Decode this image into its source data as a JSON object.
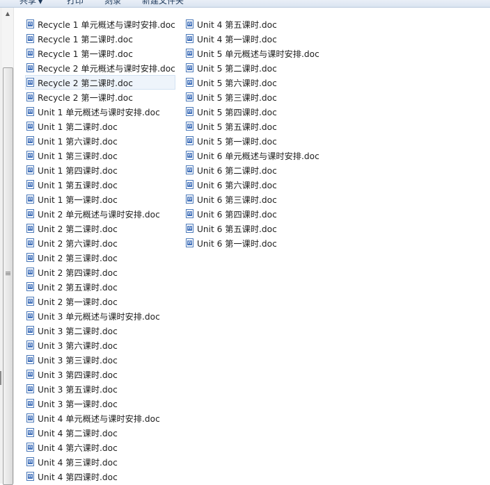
{
  "toolbar": {
    "items": [
      {
        "label": "共享",
        "has_dropdown": true
      },
      {
        "label": "打印",
        "has_dropdown": false
      },
      {
        "label": "刻录",
        "has_dropdown": false
      },
      {
        "label": "新建文件夹",
        "has_dropdown": false
      }
    ],
    "dropdown_glyph": "▼"
  },
  "scrollbar": {
    "up_glyph": "▲"
  },
  "file_icon": "word-doc-icon",
  "selected_file": "Recycle 2 第二课时.doc",
  "files": {
    "column1": [
      "Recycle 1 单元概述与课时安排.doc",
      "Recycle 1 第二课时.doc",
      "Recycle 1 第一课时.doc",
      "Recycle 2 单元概述与课时安排.doc",
      "Recycle 2 第二课时.doc",
      "Recycle 2 第一课时.doc",
      "Unit 1 单元概述与课时安排.doc",
      "Unit 1 第二课时.doc",
      "Unit 1 第六课时.doc",
      "Unit 1 第三课时.doc",
      "Unit 1 第四课时.doc",
      "Unit 1 第五课时.doc",
      "Unit 1 第一课时.doc",
      "Unit 2 单元概述与课时安排.doc",
      "Unit 2 第二课时.doc",
      "Unit 2 第六课时.doc",
      "Unit 2 第三课时.doc",
      "Unit 2 第四课时.doc",
      "Unit 2 第五课时.doc",
      "Unit 2 第一课时.doc",
      "Unit 3 单元概述与课时安排.doc",
      "Unit 3 第二课时.doc",
      "Unit 3 第六课时.doc",
      "Unit 3 第三课时.doc",
      "Unit 3 第四课时.doc",
      "Unit 3 第五课时.doc",
      "Unit 3 第一课时.doc",
      "Unit 4 单元概述与课时安排.doc",
      "Unit 4 第二课时.doc",
      "Unit 4 第六课时.doc",
      "Unit 4 第三课时.doc",
      "Unit 4 第四课时.doc"
    ],
    "column2": [
      "Unit 4 第五课时.doc",
      "Unit 4 第一课时.doc",
      "Unit 5 单元概述与课时安排.doc",
      "Unit 5 第二课时.doc",
      "Unit 5 第六课时.doc",
      "Unit 5 第三课时.doc",
      "Unit 5 第四课时.doc",
      "Unit 5 第五课时.doc",
      "Unit 5 第一课时.doc",
      "Unit 6 单元概述与课时安排.doc",
      "Unit 6 第二课时.doc",
      "Unit 6 第六课时.doc",
      "Unit 6 第三课时.doc",
      "Unit 6 第四课时.doc",
      "Unit 6 第五课时.doc",
      "Unit 6 第一课时.doc"
    ]
  }
}
